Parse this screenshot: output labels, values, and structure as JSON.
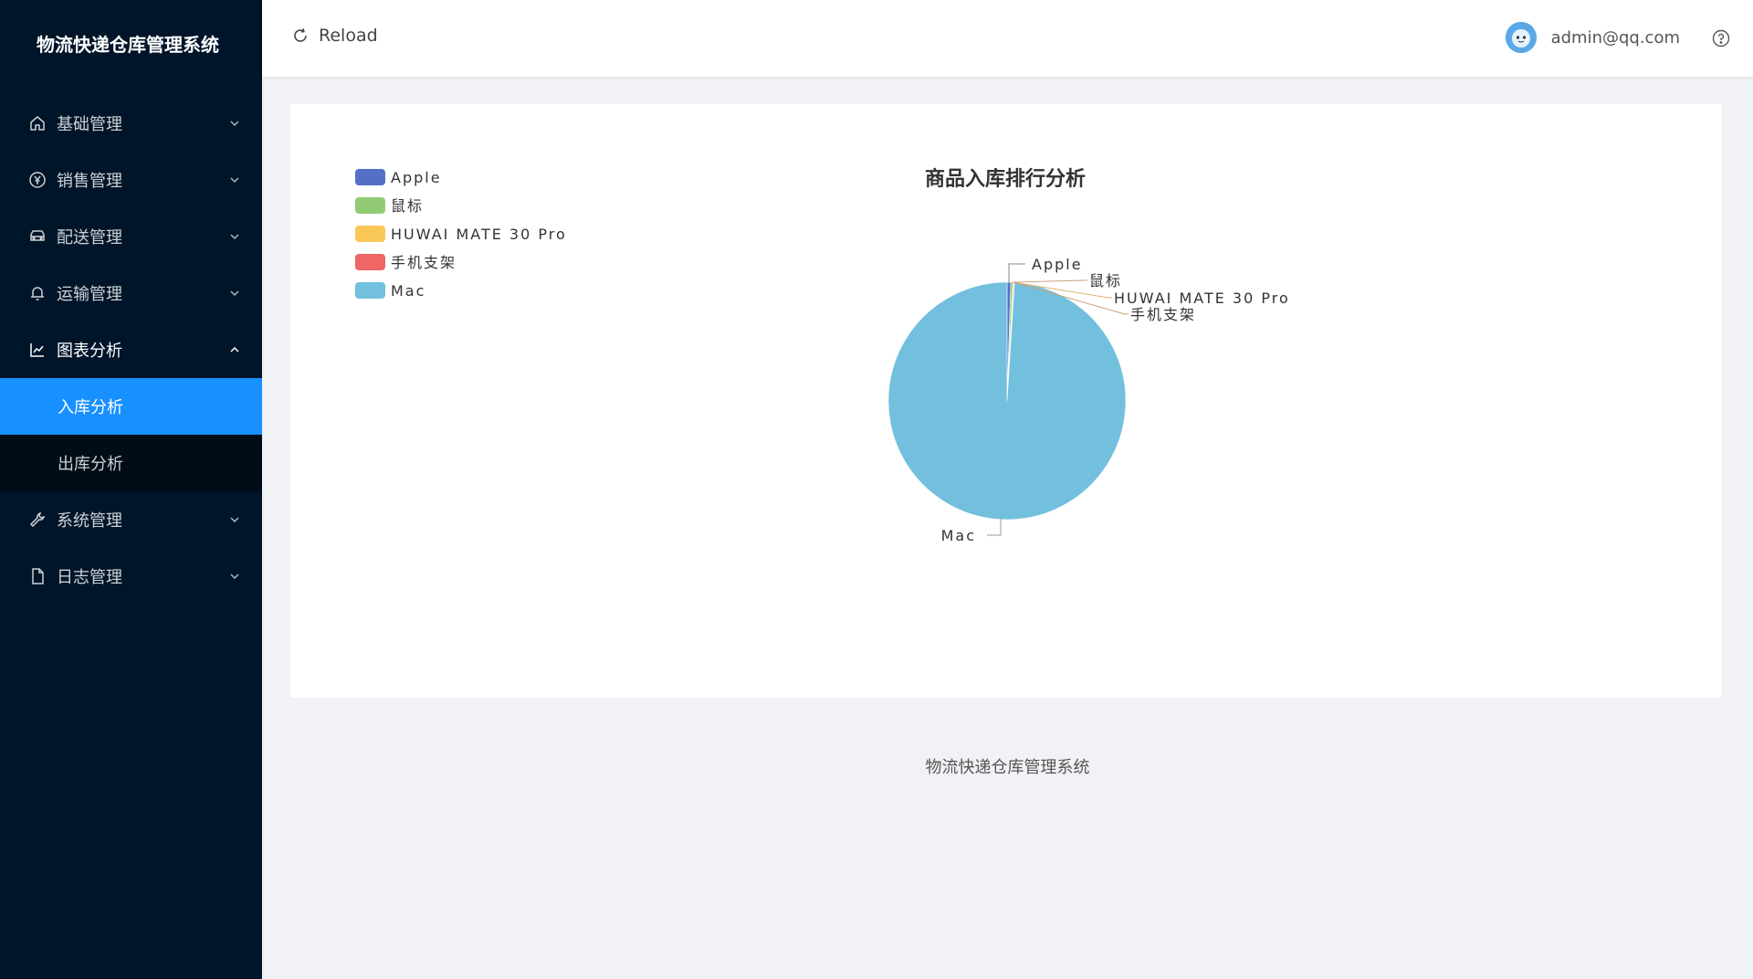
{
  "app": {
    "title": "物流快递仓库管理系统"
  },
  "sidebar": {
    "items": [
      {
        "label": "基础管理",
        "icon": "home-icon"
      },
      {
        "label": "销售管理",
        "icon": "yen-icon"
      },
      {
        "label": "配送管理",
        "icon": "truck-icon"
      },
      {
        "label": "运输管理",
        "icon": "bell-icon"
      },
      {
        "label": "图表分析",
        "icon": "line-chart-icon",
        "open": true,
        "children": [
          {
            "label": "入库分析",
            "active": true
          },
          {
            "label": "出库分析",
            "active": false
          }
        ]
      },
      {
        "label": "系统管理",
        "icon": "wrench-icon"
      },
      {
        "label": "日志管理",
        "icon": "file-icon"
      }
    ]
  },
  "header": {
    "reload_label": "Reload",
    "user_email": "admin@qq.com"
  },
  "chart_data": {
    "type": "pie",
    "title": "商品入库排行分析",
    "legend_position": "top-left",
    "categories": [
      "Apple",
      "鼠标",
      "HUWAI MATE 30 Pro",
      "手机支架",
      "Mac"
    ],
    "values": [
      5,
      3,
      1,
      1,
      990
    ],
    "colors": [
      "#5470c6",
      "#91cc75",
      "#fac858",
      "#ee6666",
      "#73c0de"
    ]
  },
  "footer": {
    "text": "物流快递仓库管理系统"
  }
}
